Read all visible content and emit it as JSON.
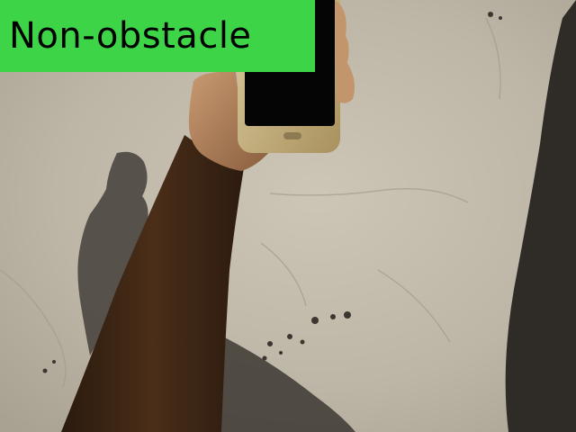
{
  "image": {
    "kind": "photograph",
    "scene": "hand-holding-smartphone-over-concrete-ground"
  },
  "label": {
    "text": "Non-obstacle",
    "background_color": "#3dd447",
    "text_color": "#000000"
  },
  "colors": {
    "ground": "#c4bdae",
    "shadow": "#3f3b36",
    "skin": "#3a2414",
    "phone_body": "#c9b27f",
    "phone_screen": "#050505"
  }
}
